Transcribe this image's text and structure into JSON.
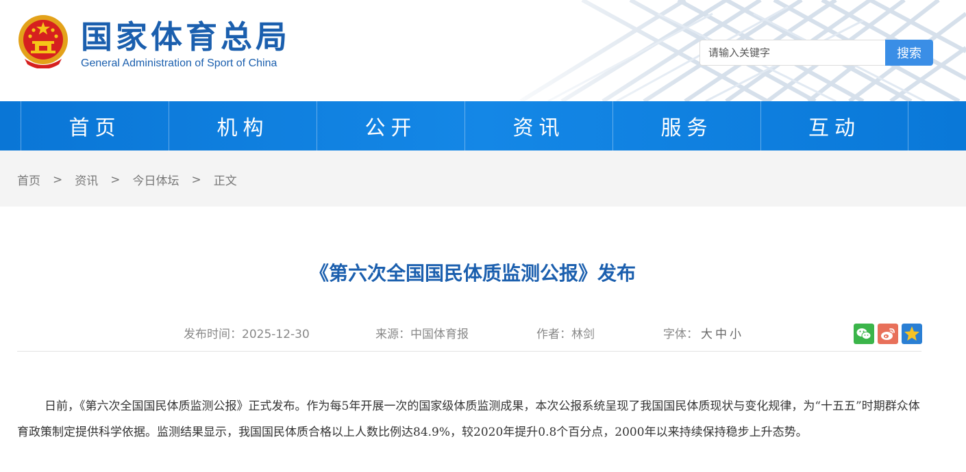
{
  "header": {
    "logo_cn": "国家体育总局",
    "logo_en": "General Administration of Sport of China",
    "search_placeholder": "请输入关键字",
    "search_button": "搜索"
  },
  "nav": {
    "items": [
      {
        "label": "首页"
      },
      {
        "label": "机构"
      },
      {
        "label": "公开"
      },
      {
        "label": "资讯"
      },
      {
        "label": "服务"
      },
      {
        "label": "互动"
      }
    ]
  },
  "breadcrumb": {
    "items": [
      "首页",
      "资讯",
      "今日体坛",
      "正文"
    ],
    "separator": ">"
  },
  "article": {
    "title": "《第六次全国国民体质监测公报》发布",
    "publish_time": "发布时间：2025-12-30",
    "source": "来源：中国体育报",
    "author": "作者：林剑",
    "font_label": "字体：",
    "font_large": "大",
    "font_medium": "中",
    "font_small": "小",
    "body": "日前，《第六次全国国民体质监测公报》正式发布。作为每5年开展一次的国家级体质监测成果，本次公报系统呈现了我国国民体质现状与变化规律，为“十五五”时期群众体育政策制定提供科学依据。监测结果显示，我国国民体质合格以上人数比例达84.9%，较2020年提升0.8个百分点，2000年以来持续保持稳步上升态势。"
  },
  "share": [
    {
      "icon": "wechat-icon",
      "color": "#3bb54a"
    },
    {
      "icon": "weibo-icon",
      "color": "#e8705a"
    },
    {
      "icon": "favorite-star-icon",
      "color": "#2a7fd4"
    }
  ],
  "colors": {
    "brand_blue": "#1b5fae",
    "nav_blue": "#1487e6",
    "search_button": "#3a8ee6"
  }
}
